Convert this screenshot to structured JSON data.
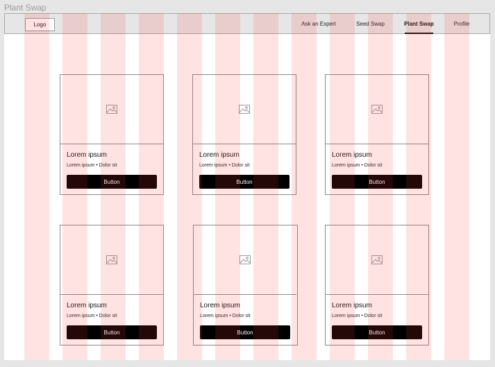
{
  "frame": {
    "title": "Plant Swap"
  },
  "nav": {
    "logo_label": "Logo",
    "links": [
      {
        "label": "Ask an Expert",
        "active": false
      },
      {
        "label": "Seed Swap",
        "active": false
      },
      {
        "label": "Plant Swap",
        "active": true
      },
      {
        "label": "Profile",
        "active": false
      }
    ]
  },
  "cards": [
    {
      "title": "Lorem ipsum",
      "subtitle": "Lorem ipsum • Dolor sit",
      "button": "Button",
      "image_icon": "image-placeholder-icon"
    },
    {
      "title": "Lorem ipsum",
      "subtitle": "Lorem ipsum • Dolor sit",
      "button": "Button",
      "image_icon": "image-placeholder-icon"
    },
    {
      "title": "Lorem ipsum",
      "subtitle": "Lorem ipsum • Dolor sit",
      "button": "Button",
      "image_icon": "image-placeholder-icon"
    },
    {
      "title": "Lorem ipsum",
      "subtitle": "Lorem ipsum • Dolor sit",
      "button": "Button",
      "image_icon": "image-placeholder-icon"
    },
    {
      "title": "Lorem ipsum",
      "subtitle": "Lorem ipsum • Dolor sit",
      "button": "Button",
      "image_icon": "image-placeholder-icon"
    },
    {
      "title": "Lorem ipsum",
      "subtitle": "Lorem ipsum • Dolor sit",
      "button": "Button",
      "image_icon": "image-placeholder-icon"
    }
  ],
  "colors": {
    "grid_column": "#ff3c3c",
    "button_bg": "#000000",
    "nav_bg": "#e6e6e6"
  }
}
